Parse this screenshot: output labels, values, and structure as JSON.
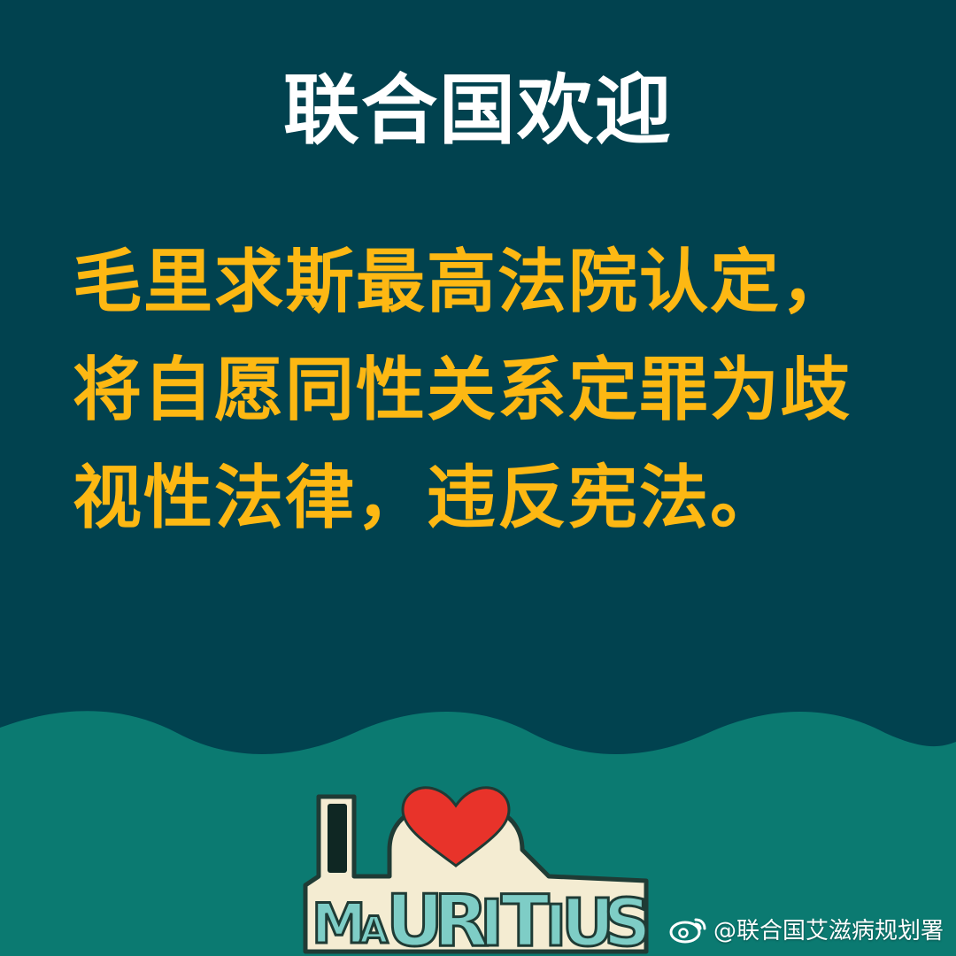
{
  "headline": "联合国欢迎",
  "statement_lines": [
    "毛里求斯最高法院认定，",
    "将自愿同性关系定罪为歧",
    "视性法律，违反宪法。"
  ],
  "logo": {
    "text": "I ♥ MAURITIUS",
    "icon": "heart-icon"
  },
  "watermark": {
    "icon": "weibo-icon",
    "text": "@联合国艾滋病规划署"
  },
  "colors": {
    "background": "#01424f",
    "headline": "#ffffff",
    "statement": "#fdb813",
    "wave": "#0b7a71",
    "logo_fill": "#7ecdc6",
    "logo_outline": "#1f3b35",
    "heart": "#e8332a"
  }
}
